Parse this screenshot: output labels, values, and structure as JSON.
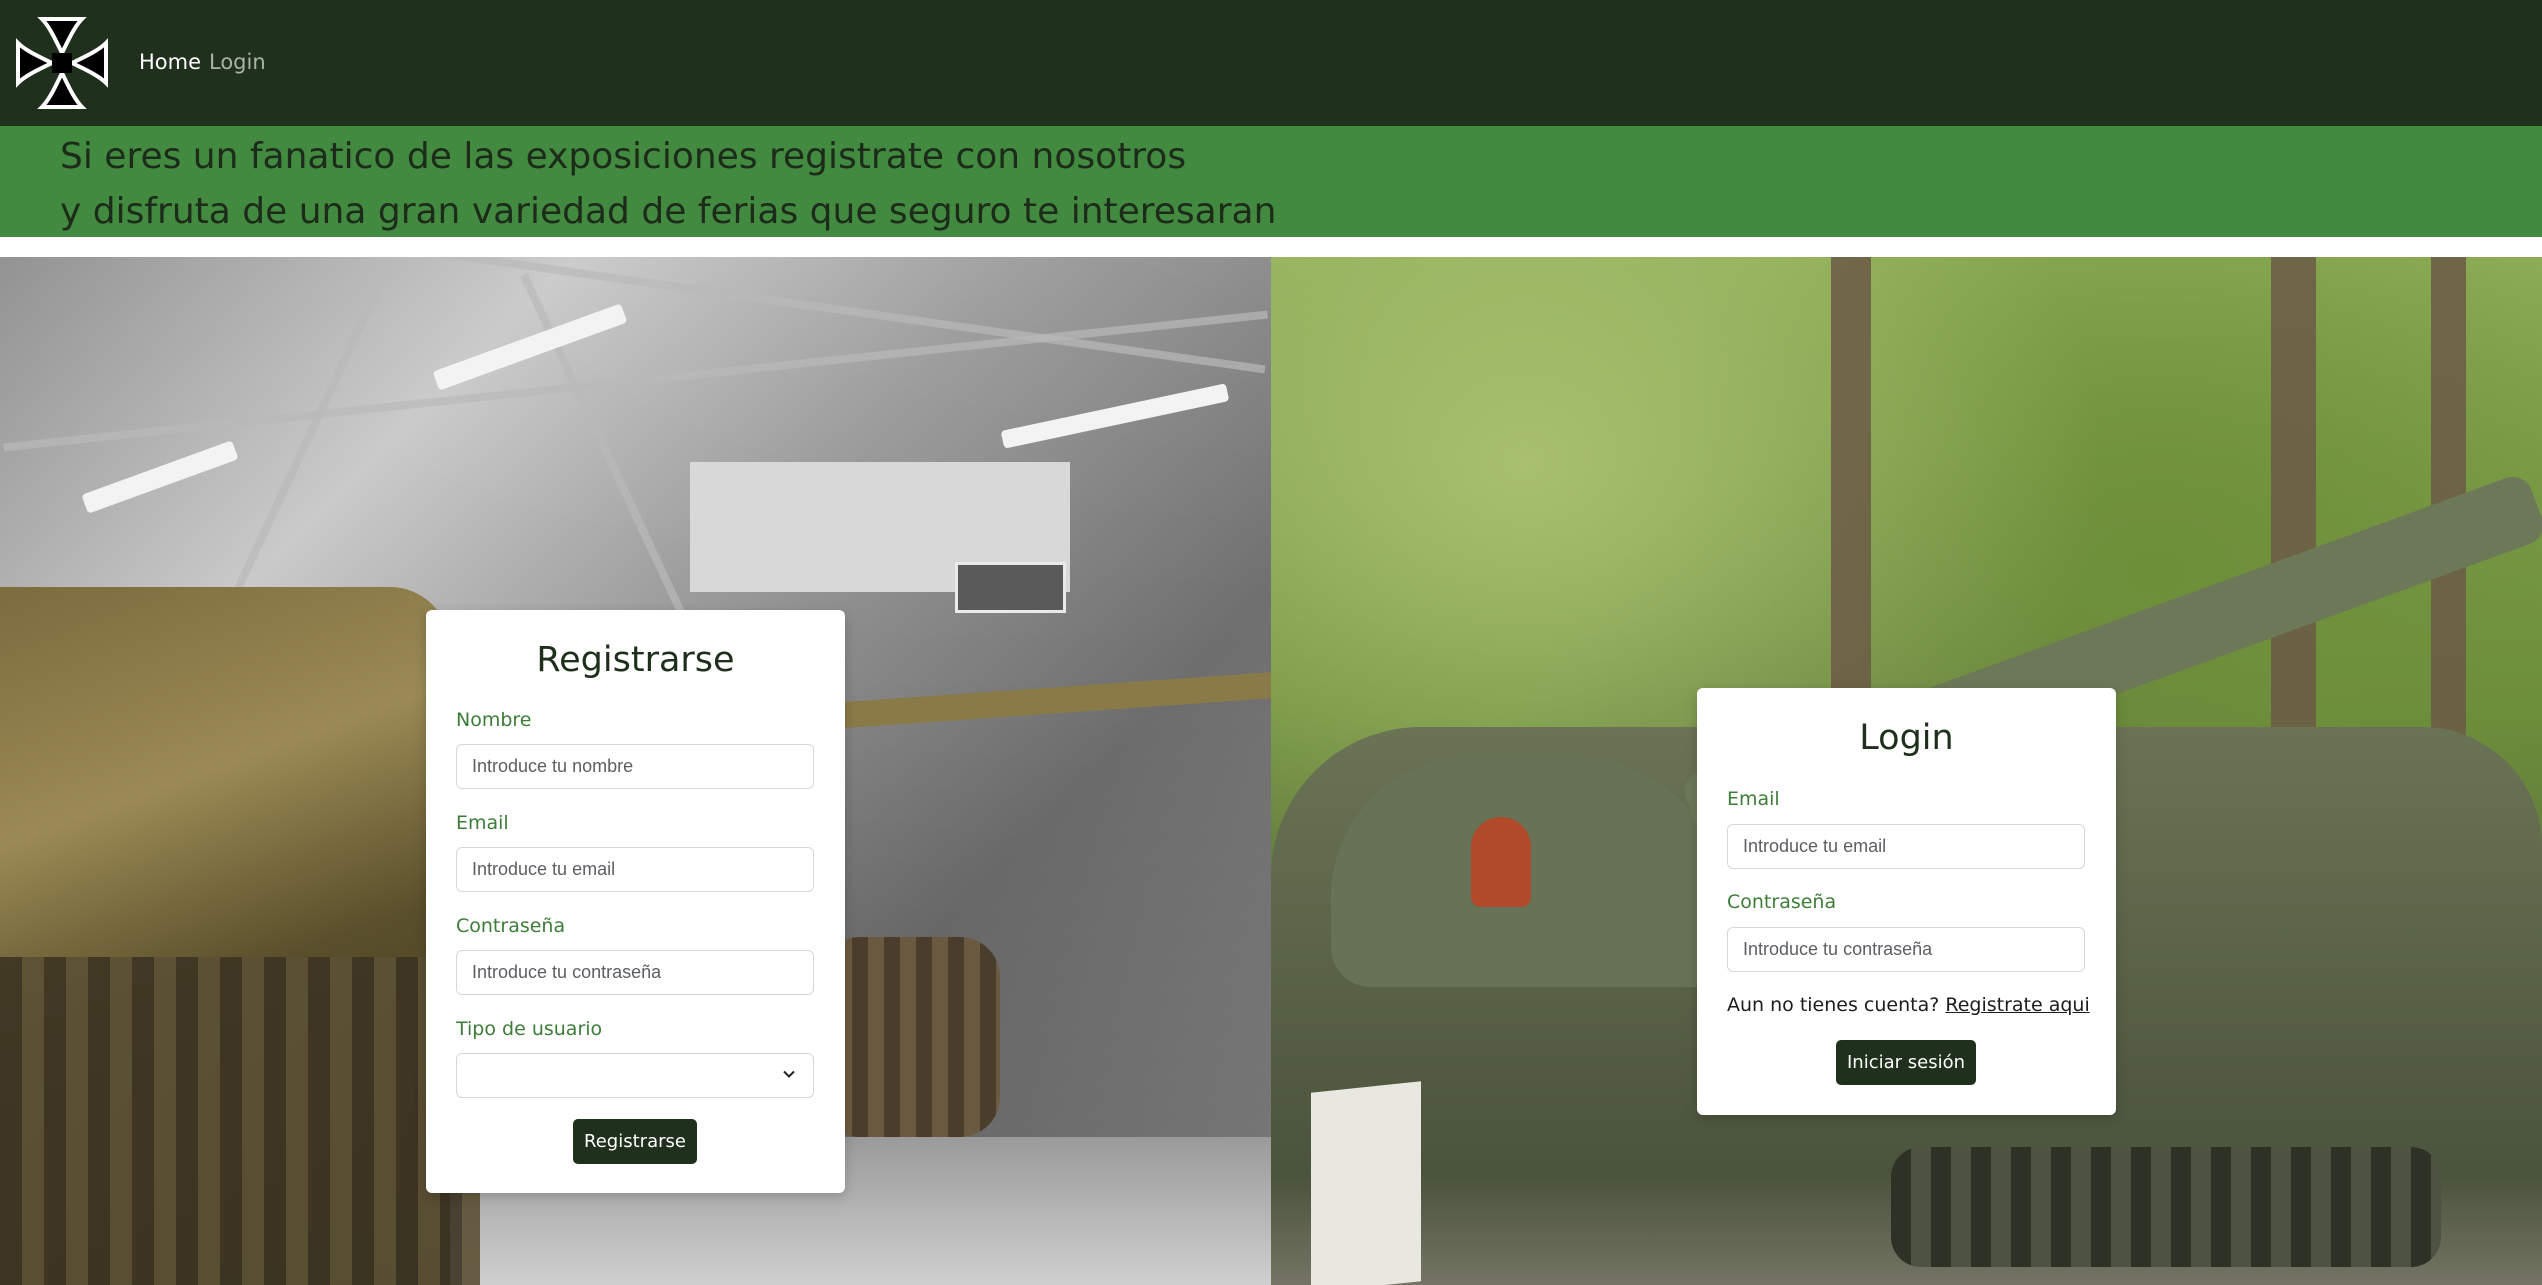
{
  "nav": {
    "home_label": "Home",
    "login_label": "Login",
    "logo_icon": "iron-cross-icon"
  },
  "banner": {
    "line1": "Si eres un fanatico de las exposiciones registrate con nosotros",
    "line2": "y disfruta de una gran variedad de ferias que seguro te interesaran"
  },
  "register": {
    "title": "Registrarse",
    "name_label": "Nombre",
    "name_placeholder": "Introduce tu nombre",
    "email_label": "Email",
    "email_placeholder": "Introduce tu email",
    "password_label": "Contraseña",
    "password_placeholder": "Introduce tu contraseña",
    "user_type_label": "Tipo de usuario",
    "user_type_value": "",
    "submit_label": "Registrarse"
  },
  "login": {
    "title": "Login",
    "email_label": "Email",
    "email_placeholder": "Introduce tu email",
    "password_label": "Contraseña",
    "password_placeholder": "Introduce tu contraseña",
    "no_account_text": "Aun no tienes cuenta?",
    "register_link": "Registrate aqui",
    "submit_label": "Iniciar sesión"
  },
  "colors": {
    "navbar": "#1f301c",
    "banner": "#428a3f",
    "label": "#3d7d38",
    "button": "#1f301c"
  }
}
